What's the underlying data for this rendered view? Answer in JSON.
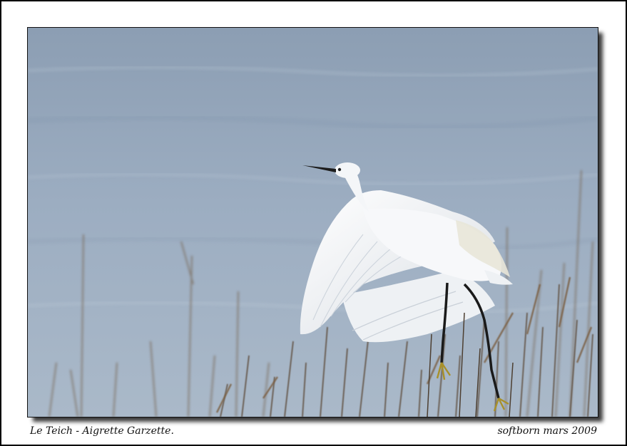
{
  "photo": {
    "subject": "little-egret-taking-off",
    "colors": {
      "water_top": "#8ea0b5",
      "water_bottom": "#a9bacb",
      "reeds": "#6b5a48",
      "plumage": "#f4f6f8",
      "legs": "#1a1a1a",
      "feet": "#b59a2a"
    }
  },
  "caption": {
    "left": "Le Teich - Aigrette Garzette.",
    "right": "softborn mars 2009"
  }
}
